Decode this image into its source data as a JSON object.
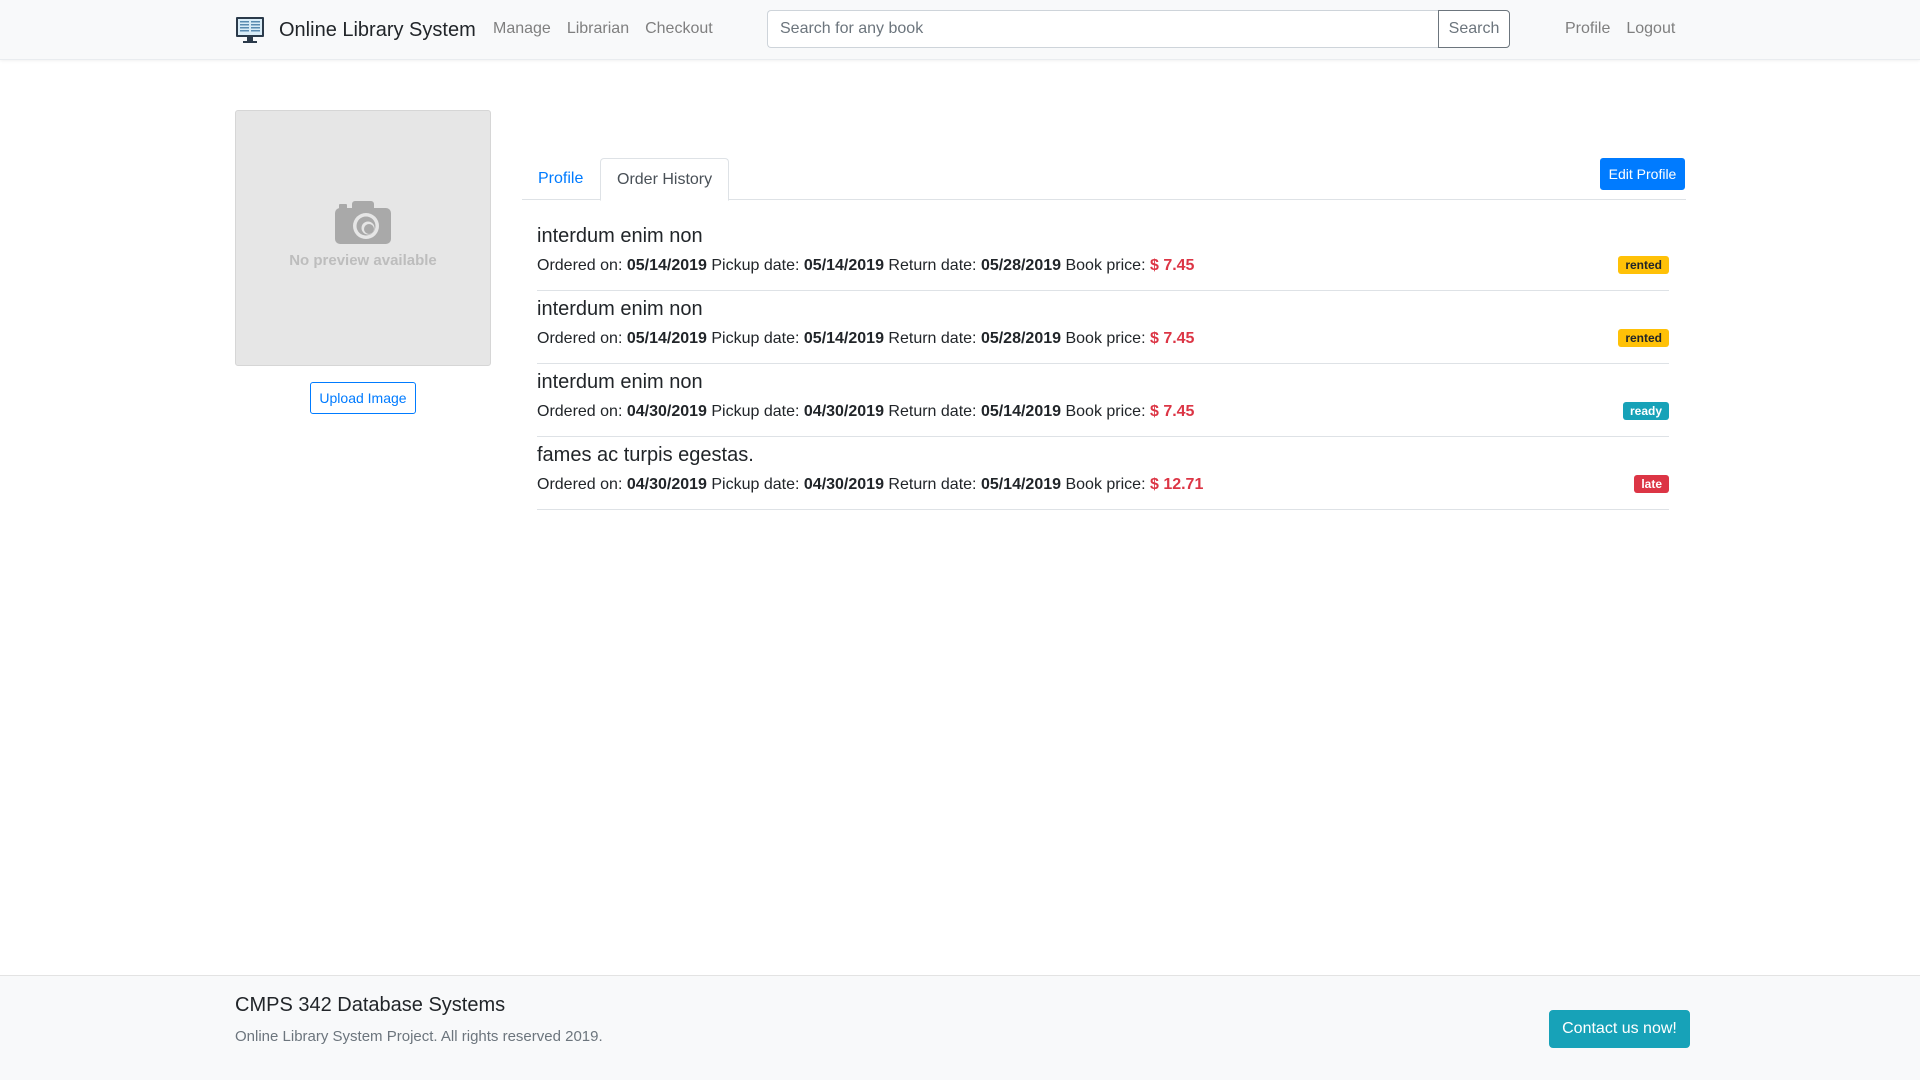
{
  "navbar": {
    "brand_icon": "computer-monitor-icon",
    "brand": "Online Library System",
    "links": [
      "Manage",
      "Librarian",
      "Checkout"
    ],
    "search_placeholder": "Search for any book",
    "search_button": "Search",
    "right_links": [
      "Profile",
      "Logout"
    ]
  },
  "avatar": {
    "icon": "camera-icon",
    "placeholder_text": "No preview available",
    "upload_button": "Upload Image"
  },
  "tabs": [
    {
      "label": "Profile",
      "active": false
    },
    {
      "label": "Order History",
      "active": true
    }
  ],
  "edit_profile_button": "Edit Profile",
  "labels": {
    "ordered_on": "Ordered on:",
    "pickup_date": "Pickup date:",
    "return_date": "Return date:",
    "book_price": "Book price:"
  },
  "orders": [
    {
      "title": "interdum enim non",
      "ordered_on": "05/14/2019",
      "pickup_date": "05/14/2019",
      "return_date": "05/28/2019",
      "price": "$ 7.45",
      "status": "rented"
    },
    {
      "title": "interdum enim non",
      "ordered_on": "05/14/2019",
      "pickup_date": "05/14/2019",
      "return_date": "05/28/2019",
      "price": "$ 7.45",
      "status": "rented"
    },
    {
      "title": "interdum enim non",
      "ordered_on": "04/30/2019",
      "pickup_date": "04/30/2019",
      "return_date": "05/14/2019",
      "price": "$ 7.45",
      "status": "ready"
    },
    {
      "title": "fames ac turpis egestas.",
      "ordered_on": "04/30/2019",
      "pickup_date": "04/30/2019",
      "return_date": "05/14/2019",
      "price": "$ 12.71",
      "status": "late"
    }
  ],
  "status_colors": {
    "rented": "#ffc107",
    "ready": "#17a2b8",
    "late": "#dc3545"
  },
  "footer": {
    "title": "CMPS 342 Database Systems",
    "subtitle": "Online Library System Project. All rights reserved 2019.",
    "contact_button": "Contact us now!"
  }
}
